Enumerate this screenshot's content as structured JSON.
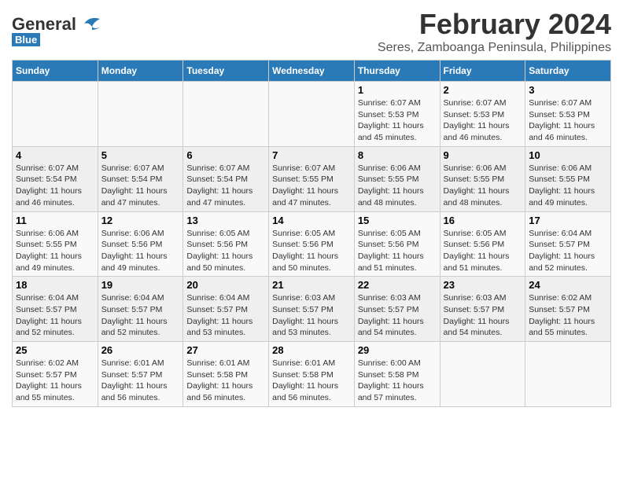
{
  "logo": {
    "line1": "General",
    "line2": "Blue"
  },
  "title": "February 2024",
  "subtitle": "Seres, Zamboanga Peninsula, Philippines",
  "weekdays": [
    "Sunday",
    "Monday",
    "Tuesday",
    "Wednesday",
    "Thursday",
    "Friday",
    "Saturday"
  ],
  "weeks": [
    [
      {
        "day": "",
        "info": ""
      },
      {
        "day": "",
        "info": ""
      },
      {
        "day": "",
        "info": ""
      },
      {
        "day": "",
        "info": ""
      },
      {
        "day": "1",
        "info": "Sunrise: 6:07 AM\nSunset: 5:53 PM\nDaylight: 11 hours\nand 45 minutes."
      },
      {
        "day": "2",
        "info": "Sunrise: 6:07 AM\nSunset: 5:53 PM\nDaylight: 11 hours\nand 46 minutes."
      },
      {
        "day": "3",
        "info": "Sunrise: 6:07 AM\nSunset: 5:53 PM\nDaylight: 11 hours\nand 46 minutes."
      }
    ],
    [
      {
        "day": "4",
        "info": "Sunrise: 6:07 AM\nSunset: 5:54 PM\nDaylight: 11 hours\nand 46 minutes."
      },
      {
        "day": "5",
        "info": "Sunrise: 6:07 AM\nSunset: 5:54 PM\nDaylight: 11 hours\nand 47 minutes."
      },
      {
        "day": "6",
        "info": "Sunrise: 6:07 AM\nSunset: 5:54 PM\nDaylight: 11 hours\nand 47 minutes."
      },
      {
        "day": "7",
        "info": "Sunrise: 6:07 AM\nSunset: 5:55 PM\nDaylight: 11 hours\nand 47 minutes."
      },
      {
        "day": "8",
        "info": "Sunrise: 6:06 AM\nSunset: 5:55 PM\nDaylight: 11 hours\nand 48 minutes."
      },
      {
        "day": "9",
        "info": "Sunrise: 6:06 AM\nSunset: 5:55 PM\nDaylight: 11 hours\nand 48 minutes."
      },
      {
        "day": "10",
        "info": "Sunrise: 6:06 AM\nSunset: 5:55 PM\nDaylight: 11 hours\nand 49 minutes."
      }
    ],
    [
      {
        "day": "11",
        "info": "Sunrise: 6:06 AM\nSunset: 5:55 PM\nDaylight: 11 hours\nand 49 minutes."
      },
      {
        "day": "12",
        "info": "Sunrise: 6:06 AM\nSunset: 5:56 PM\nDaylight: 11 hours\nand 49 minutes."
      },
      {
        "day": "13",
        "info": "Sunrise: 6:05 AM\nSunset: 5:56 PM\nDaylight: 11 hours\nand 50 minutes."
      },
      {
        "day": "14",
        "info": "Sunrise: 6:05 AM\nSunset: 5:56 PM\nDaylight: 11 hours\nand 50 minutes."
      },
      {
        "day": "15",
        "info": "Sunrise: 6:05 AM\nSunset: 5:56 PM\nDaylight: 11 hours\nand 51 minutes."
      },
      {
        "day": "16",
        "info": "Sunrise: 6:05 AM\nSunset: 5:56 PM\nDaylight: 11 hours\nand 51 minutes."
      },
      {
        "day": "17",
        "info": "Sunrise: 6:04 AM\nSunset: 5:57 PM\nDaylight: 11 hours\nand 52 minutes."
      }
    ],
    [
      {
        "day": "18",
        "info": "Sunrise: 6:04 AM\nSunset: 5:57 PM\nDaylight: 11 hours\nand 52 minutes."
      },
      {
        "day": "19",
        "info": "Sunrise: 6:04 AM\nSunset: 5:57 PM\nDaylight: 11 hours\nand 52 minutes."
      },
      {
        "day": "20",
        "info": "Sunrise: 6:04 AM\nSunset: 5:57 PM\nDaylight: 11 hours\nand 53 minutes."
      },
      {
        "day": "21",
        "info": "Sunrise: 6:03 AM\nSunset: 5:57 PM\nDaylight: 11 hours\nand 53 minutes."
      },
      {
        "day": "22",
        "info": "Sunrise: 6:03 AM\nSunset: 5:57 PM\nDaylight: 11 hours\nand 54 minutes."
      },
      {
        "day": "23",
        "info": "Sunrise: 6:03 AM\nSunset: 5:57 PM\nDaylight: 11 hours\nand 54 minutes."
      },
      {
        "day": "24",
        "info": "Sunrise: 6:02 AM\nSunset: 5:57 PM\nDaylight: 11 hours\nand 55 minutes."
      }
    ],
    [
      {
        "day": "25",
        "info": "Sunrise: 6:02 AM\nSunset: 5:57 PM\nDaylight: 11 hours\nand 55 minutes."
      },
      {
        "day": "26",
        "info": "Sunrise: 6:01 AM\nSunset: 5:57 PM\nDaylight: 11 hours\nand 56 minutes."
      },
      {
        "day": "27",
        "info": "Sunrise: 6:01 AM\nSunset: 5:58 PM\nDaylight: 11 hours\nand 56 minutes."
      },
      {
        "day": "28",
        "info": "Sunrise: 6:01 AM\nSunset: 5:58 PM\nDaylight: 11 hours\nand 56 minutes."
      },
      {
        "day": "29",
        "info": "Sunrise: 6:00 AM\nSunset: 5:58 PM\nDaylight: 11 hours\nand 57 minutes."
      },
      {
        "day": "",
        "info": ""
      },
      {
        "day": "",
        "info": ""
      }
    ]
  ]
}
